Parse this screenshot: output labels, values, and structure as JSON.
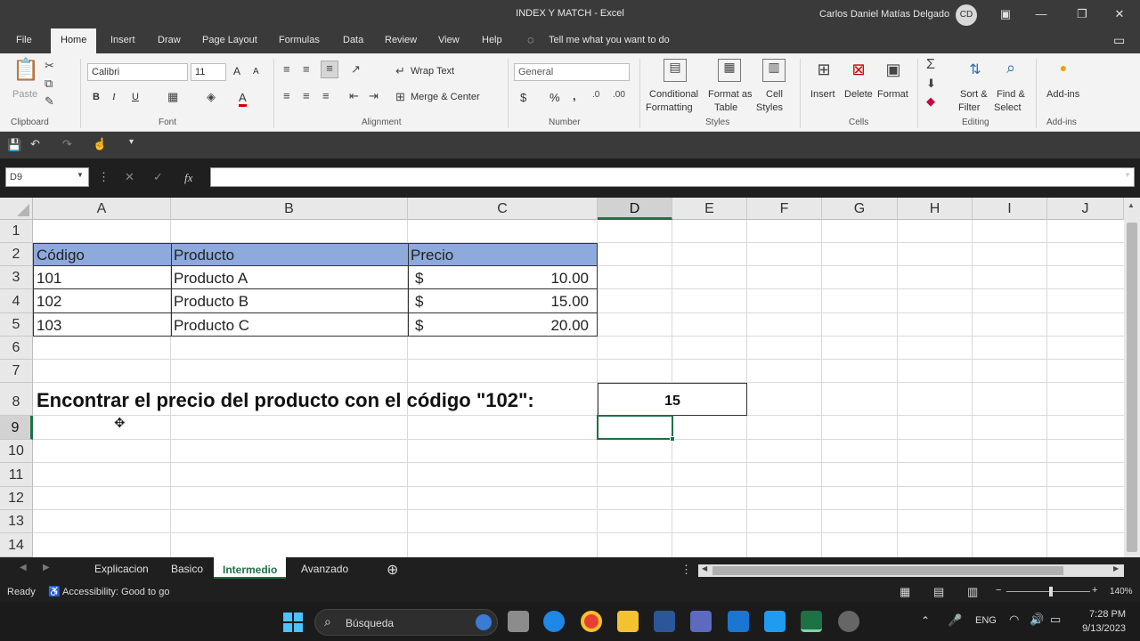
{
  "titlebar": {
    "title": "INDEX Y MATCH  -  Excel",
    "user": "Carlos Daniel Matías Delgado",
    "initials": "CD"
  },
  "tabs": [
    "File",
    "Home",
    "Insert",
    "Draw",
    "Page Layout",
    "Formulas",
    "Data",
    "Review",
    "View",
    "Help"
  ],
  "tellme": "Tell me what you want to do",
  "ribbon": {
    "clipboard": {
      "paste": "Paste",
      "group": "Clipboard"
    },
    "font": {
      "name": "Calibri",
      "size": "11",
      "bold": "B",
      "italic": "I",
      "underline": "U",
      "grow": "A",
      "shrink": "A",
      "color": "A",
      "group": "Font"
    },
    "alignment": {
      "wrap": "Wrap Text",
      "merge": "Merge & Center",
      "group": "Alignment"
    },
    "number": {
      "format": "General",
      "currency": "$",
      "percent": "%",
      "comma": ",",
      "group": "Number"
    },
    "styles": {
      "cond1": "Conditional",
      "cond2": "Formatting",
      "fmt1": "Format as",
      "fmt2": "Table",
      "cell1": "Cell",
      "cell2": "Styles",
      "group": "Styles"
    },
    "cells": {
      "insert": "Insert",
      "delete": "Delete",
      "format": "Format",
      "group": "Cells"
    },
    "editing": {
      "sort1": "Sort &",
      "sort2": "Filter",
      "find1": "Find &",
      "find2": "Select",
      "group": "Editing"
    },
    "addins": {
      "label": "Add-ins",
      "group": "Add-ins"
    }
  },
  "formula_bar": {
    "name_box": "D9",
    "fx": "fx",
    "value": ""
  },
  "columns": [
    "A",
    "B",
    "C",
    "D",
    "E",
    "F",
    "G",
    "H",
    "I",
    "J"
  ],
  "rows": [
    "1",
    "2",
    "3",
    "4",
    "5",
    "6",
    "7",
    "8",
    "9",
    "10",
    "11",
    "12",
    "13",
    "14"
  ],
  "table": {
    "headers": [
      "Código",
      "Producto",
      "Precio"
    ],
    "rows": [
      {
        "code": "101",
        "product": "Producto A",
        "currency": "$",
        "price": "10.00"
      },
      {
        "code": "102",
        "product": "Producto B",
        "currency": "$",
        "price": "15.00"
      },
      {
        "code": "103",
        "product": "Producto C",
        "currency": "$",
        "price": "20.00"
      }
    ]
  },
  "question": "Encontrar el precio del producto con el código \"102\":",
  "answer": "15",
  "sheets": [
    "Explicacion",
    "Basico",
    "Intermedio",
    "Avanzado"
  ],
  "active_sheet": "Intermedio",
  "status": {
    "ready": "Ready",
    "accessibility": "Accessibility: Good to go",
    "zoom": "140%"
  },
  "taskbar": {
    "search": "Búsqueda",
    "lang": "ENG",
    "time": "7:28 PM",
    "date": "9/13/2023"
  },
  "colors": {
    "header_fill": "#8ea9db",
    "excel_green": "#1e7145"
  }
}
